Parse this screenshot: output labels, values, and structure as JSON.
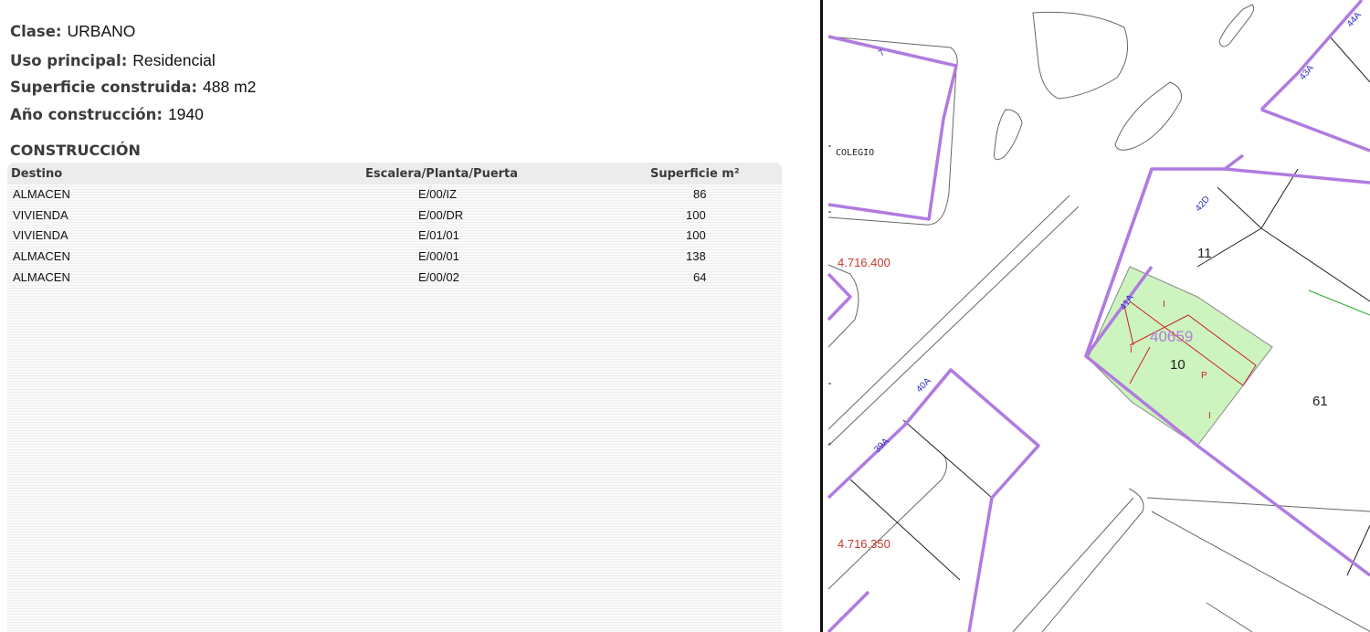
{
  "info": {
    "clase_label": "Clase:",
    "clase_value": "URBANO",
    "uso_label": "Uso principal:",
    "uso_value": "Residencial",
    "superficie_label": "Superficie construida:",
    "superficie_value": "488 m2",
    "anio_label": "Año construcción:",
    "anio_value": "1940"
  },
  "construccion": {
    "title": "CONSTRUCCIÓN",
    "headers": [
      "Destino",
      "Escalera/Planta/Puerta",
      "Superficie m²"
    ],
    "rows": [
      {
        "destino": "ALMACEN",
        "epp": "E/00/IZ",
        "superficie": "86"
      },
      {
        "destino": "VIVIENDA",
        "epp": "E/00/DR",
        "superficie": "100"
      },
      {
        "destino": "VIVIENDA",
        "epp": "E/01/01",
        "superficie": "100"
      },
      {
        "destino": "ALMACEN",
        "epp": "E/00/01",
        "superficie": "138"
      },
      {
        "destino": "ALMACEN",
        "epp": "E/00/02",
        "superficie": "64"
      }
    ]
  },
  "map": {
    "colegio_label": "COLEGIO",
    "coord_top": "4.716.400",
    "coord_bottom": "4.716.350",
    "parcel_id": "40659",
    "parcel_number": "10",
    "lot_11": "11",
    "lot_61": "61",
    "street_numbers": [
      "7",
      "44A",
      "43A",
      "42D",
      "41A",
      "40A",
      "39A"
    ],
    "floor_marks": [
      "I",
      "I",
      "P",
      "I"
    ],
    "colors": {
      "boundary": "#b07be0",
      "parcel_fill": "#cdf4bf",
      "red_lines": "#cc2222",
      "coord_text": "#c0392b",
      "street_text": "#2b2bc0",
      "parcel_label": "#b080d8"
    }
  }
}
